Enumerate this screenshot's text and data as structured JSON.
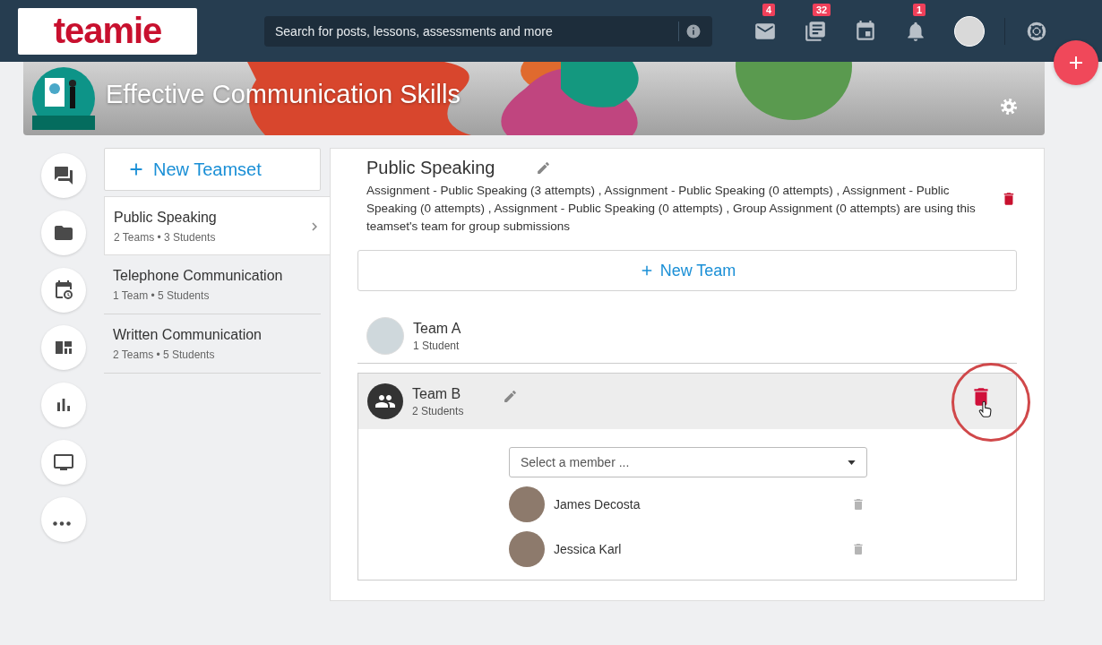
{
  "header": {
    "logo": "teamie",
    "search": {
      "placeholder": "Search for posts, lessons, assessments and more"
    },
    "icons": [
      {
        "kind": "mail",
        "badge": "4"
      },
      {
        "kind": "posts",
        "badge": "32"
      },
      {
        "kind": "calendar"
      },
      {
        "kind": "bell",
        "badge": "1"
      },
      {
        "kind": "avatar"
      },
      {
        "kind": "help"
      }
    ]
  },
  "course": {
    "title": "Effective Communication Skills"
  },
  "side_nav": [
    {
      "kind": "chat"
    },
    {
      "kind": "folder"
    },
    {
      "kind": "schedule"
    },
    {
      "kind": "dashboard"
    },
    {
      "kind": "chart"
    },
    {
      "kind": "monitor"
    },
    {
      "kind": "more"
    }
  ],
  "teamsets": {
    "new_label": "New Teamset",
    "items": [
      {
        "name": "Public Speaking",
        "counts": "2 Teams • 3 Students",
        "selected": true
      },
      {
        "name": "Telephone Communication",
        "counts": "1 Team • 5 Students",
        "selected": false
      },
      {
        "name": "Written Communication",
        "counts": "2 Teams • 5 Students",
        "selected": false
      }
    ]
  },
  "detail": {
    "title": "Public Speaking",
    "notice": "Assignment - Public Speaking (3 attempts) , Assignment - Public Speaking (0 attempts) , Assignment - Public Speaking (0 attempts) , Assignment - Public Speaking (0 attempts) , Group Assignment (0 attempts) are using this teamset's team for group submissions",
    "new_team": "New Team",
    "teams": [
      {
        "name": "Team A",
        "count": "1 Student",
        "kind": "photo",
        "expanded": false,
        "highlighted": false
      },
      {
        "name": "Team B",
        "count": "2 Students",
        "kind": "group",
        "expanded": true,
        "highlighted": true,
        "select_placeholder": "Select a member ...",
        "members": [
          {
            "name": "James Decosta"
          },
          {
            "name": "Jessica Karl"
          }
        ]
      }
    ]
  }
}
